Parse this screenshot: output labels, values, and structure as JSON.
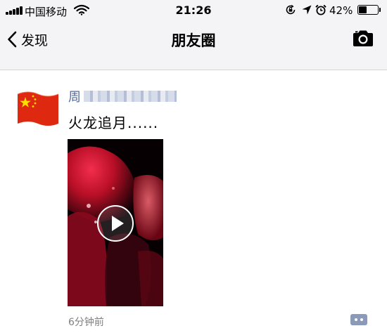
{
  "status_bar": {
    "carrier": "中国移动",
    "time": "21:26",
    "battery_percent": "42%",
    "battery_level": 0.42,
    "icons": [
      "signal-icon",
      "wifi-icon",
      "orientation-lock-icon",
      "location-icon",
      "alarm-icon",
      "battery-icon"
    ]
  },
  "nav": {
    "back_label": "发现",
    "title": "朋友圈",
    "right_icon": "camera-icon"
  },
  "post": {
    "author_name": "周",
    "author_name_obscured": true,
    "avatar": "china-flag-avatar",
    "text": "火龙追月......",
    "media": "video-thumbnail",
    "time_ago": "6分钟前",
    "action_icon": "comment-icon"
  },
  "colors": {
    "link_blue": "#576b95",
    "nav_background": "#f4f4f6",
    "flag_red": "#de2910",
    "flag_yellow": "#ffde00"
  }
}
